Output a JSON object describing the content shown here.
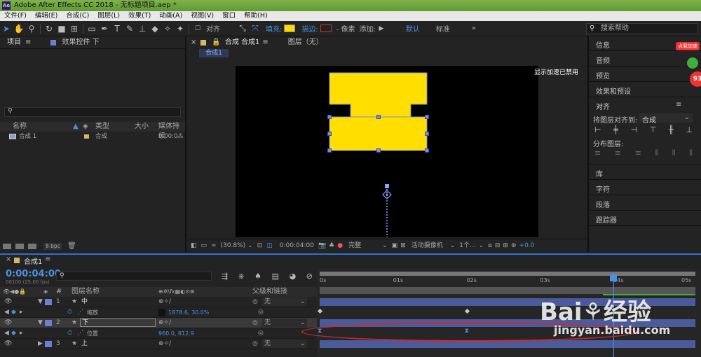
{
  "window": {
    "title": "Adobe After Effects CC 2018 - 无标题项目.aep *",
    "logo": "Ae"
  },
  "menu": [
    "文件(F)",
    "编辑(E)",
    "合成(C)",
    "图层(L)",
    "效果(T)",
    "动画(A)",
    "视图(V)",
    "窗口",
    "帮助(H)"
  ],
  "toolbar": {
    "align_label": "对齐",
    "fill_label": "填充:",
    "stroke_label": "描边:",
    "stroke_value": "- 像素",
    "add_label": "添加:",
    "workspace_default": "默认",
    "workspace_standard": "标准",
    "search_placeholder": "搜索帮助",
    "fill_color": "#ffd900"
  },
  "project_panel": {
    "tab_project": "项目",
    "tab_effects": "效果控件 下",
    "columns": {
      "name": "名称",
      "type": "类型",
      "size": "大小",
      "media": "媒体持续"
    },
    "row": {
      "name": "合成 1",
      "type": "合成",
      "duration": "0:00:0"
    },
    "bpc": "8 bpc"
  },
  "viewer": {
    "tab_comp": "合成 合成1",
    "tab_layer": "图层（无）",
    "breadcrumb": "合成1",
    "gpu_notice": "显示加速已禁用",
    "zoom": "(30.8%)",
    "timecode": "0:00:04:00",
    "resolution": "完整",
    "camera": "活动摄像机",
    "views": "1个...",
    "exposure": "+0.0",
    "shape_color": "#ffde00"
  },
  "right_panel": {
    "info": "信息",
    "audio": "音频",
    "preview": "预览",
    "effects_presets": "效果和预设",
    "align": "对齐",
    "align_to_label": "将图层对齐到:",
    "align_to_value": "合成",
    "distribute": "分布图层:",
    "library": "库",
    "character": "字符",
    "paragraph": "段落",
    "tracker": "跟踪器",
    "badge_text": "点我加速",
    "badge_number": "93"
  },
  "timeline": {
    "tab": "合成1",
    "timecode": "0:00:04:00",
    "fps": "00100 (25.00 fps)",
    "col_layer_name": "图层名称",
    "col_parent": "父级和链接",
    "ruler": [
      "0s",
      "01s",
      "02s",
      "03s",
      "04s",
      "05s"
    ],
    "playhead_seconds": 4.0,
    "duration_seconds": 5.0,
    "layers": [
      {
        "index": "1",
        "name": "中",
        "parent": "无"
      },
      {
        "index": "2",
        "name": "下",
        "parent": "无"
      },
      {
        "index": "3",
        "name": "上",
        "parent": "无"
      }
    ],
    "props": [
      {
        "name": "缩放",
        "value": "1878.6, 30.0%"
      },
      {
        "name": "位置",
        "value": "960.0, 812.9"
      }
    ],
    "scale_keyframes_seconds": [
      0.0,
      2.0
    ],
    "position_keyframes_seconds": [
      0.0,
      2.0
    ]
  },
  "watermark": {
    "brand": "Bai",
    "brand2": "经验",
    "url": "jingyan.baidu.com"
  }
}
